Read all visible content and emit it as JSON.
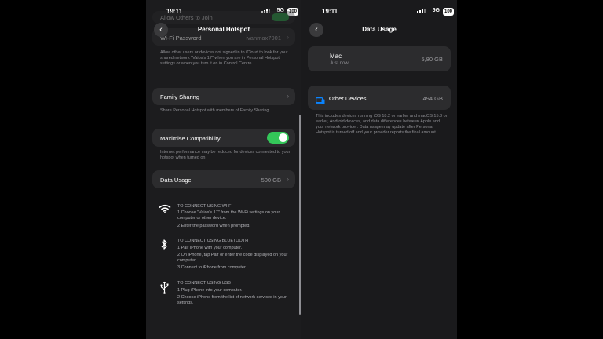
{
  "left": {
    "status": {
      "time": "19:11",
      "network": "5G",
      "battery": "100"
    },
    "nav": {
      "title": "Personal Hotspot"
    },
    "top_partial": {
      "text": "Allow Others to Join"
    },
    "wifi_password": {
      "label": "Wi-Fi Password",
      "value": "ivanmax7901"
    },
    "allow_note": "Allow other users or devices not signed in to iCloud to look for your shared network \"Vaios's 17\" when you are in Personal Hotspot settings or when you turn it on in Control Centre.",
    "family_sharing": {
      "label": "Family Sharing",
      "note": "Share Personal Hotspot with members of Family Sharing."
    },
    "maximise": {
      "label": "Maximise Compatibility",
      "enabled": true,
      "note": "Internet performance may be reduced for devices connected to your hotspot when turned on."
    },
    "data_usage": {
      "label": "Data Usage",
      "value": "500 GB"
    },
    "wifi_section": {
      "icon": "wifi-icon",
      "title": "TO CONNECT USING WI-FI",
      "steps": [
        "1 Choose \"Vaios's 17\" from the Wi-Fi settings on your computer or other device.",
        "2 Enter the password when prompted."
      ]
    },
    "bluetooth_section": {
      "icon": "bluetooth-icon",
      "title": "TO CONNECT USING BLUETOOTH",
      "steps": [
        "1 Pair iPhone with your computer.",
        "2 On iPhone, tap Pair or enter the code displayed on your computer.",
        "3 Connect to iPhone from computer."
      ]
    },
    "usb_section": {
      "icon": "usb-icon",
      "title": "TO CONNECT USING USB",
      "steps": [
        "1 Plug iPhone into your computer.",
        "2 Choose iPhone from the list of network services in your settings."
      ]
    }
  },
  "right": {
    "status": {
      "time": "19:11",
      "network": "5G",
      "battery": "100"
    },
    "nav": {
      "title": "Data Usage"
    },
    "mac": {
      "name": "Mac",
      "subtitle": "Just now",
      "value": "5,80 GB"
    },
    "other_devices": {
      "label": "Other Devices",
      "value": "494 GB",
      "icon": "devices-icon"
    },
    "note": "This includes devices running iOS 18.2 or earlier and macOS 15.3 or earlier, Android devices, and data differences between Apple and your network provider. Data usage may update after Personal Hotspot is turned off and your provider reports the final amount."
  },
  "colors": {
    "toggle_on": "#34c759",
    "accent_blue": "#0a84ff",
    "card": "#2c2c2e",
    "background": "#1c1c1e"
  }
}
